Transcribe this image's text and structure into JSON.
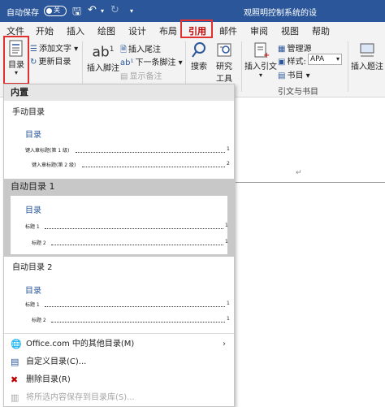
{
  "titlebar": {
    "autosave_label": "自动保存",
    "autosave_state": "关",
    "title_fragment": "观照明控制系统的设"
  },
  "tabs": [
    {
      "label": "文件"
    },
    {
      "label": "开始"
    },
    {
      "label": "插入"
    },
    {
      "label": "绘图"
    },
    {
      "label": "设计"
    },
    {
      "label": "布局"
    },
    {
      "label": "引用",
      "active": true
    },
    {
      "label": "邮件"
    },
    {
      "label": "审阅"
    },
    {
      "label": "视图"
    },
    {
      "label": "帮助"
    }
  ],
  "ribbon": {
    "toc": {
      "label": "目录"
    },
    "add_text": "添加文字",
    "update_toc": "更新目录",
    "insert_footnote": {
      "icon_text": "ab",
      "superscript": "1",
      "label": "插入脚注"
    },
    "insert_endnote": "插入尾注",
    "next_footnote": "下一条脚注",
    "show_notes": "显示备注",
    "search": "搜索",
    "researcher": {
      "line1": "研究",
      "line2": "工具"
    },
    "insert_citation": "插入引文",
    "manage_sources": "管理源",
    "style_label": "样式:",
    "style_value": "APA",
    "bibliography": "书目",
    "group_citations": "引文与书目",
    "insert_caption": "插入题注"
  },
  "gallery": {
    "builtin_header": "内置",
    "manual": {
      "title": "手动目录",
      "preview_title": "目录",
      "line1": "键入章标题(第 1 级)",
      "page1": "1",
      "line2": "键入章标题(第 2 级)",
      "page2": "2"
    },
    "auto1": {
      "title": "自动目录 1",
      "preview_title": "目录",
      "line1": "标题 1",
      "page1": "1",
      "line2": "标题 2",
      "page2": "1"
    },
    "auto2": {
      "title": "自动目录 2",
      "preview_title": "目录",
      "line1": "标题 1",
      "page1": "1",
      "line2": "标题 2",
      "page2": "1"
    }
  },
  "menu_items": {
    "more_toc": "Office.com 中的其他目录(M)",
    "custom_toc": "自定义目录(C)...",
    "remove_toc": "删除目录(R)",
    "save_selection": "将所选内容保存到目录库(S)..."
  },
  "doc": {
    "paragraph_mark": "↵"
  },
  "colors": {
    "titlebar": "#2b579a",
    "active_tab": "#c00000",
    "highlight": "#e03030",
    "toc_blue": "#2b579a"
  }
}
